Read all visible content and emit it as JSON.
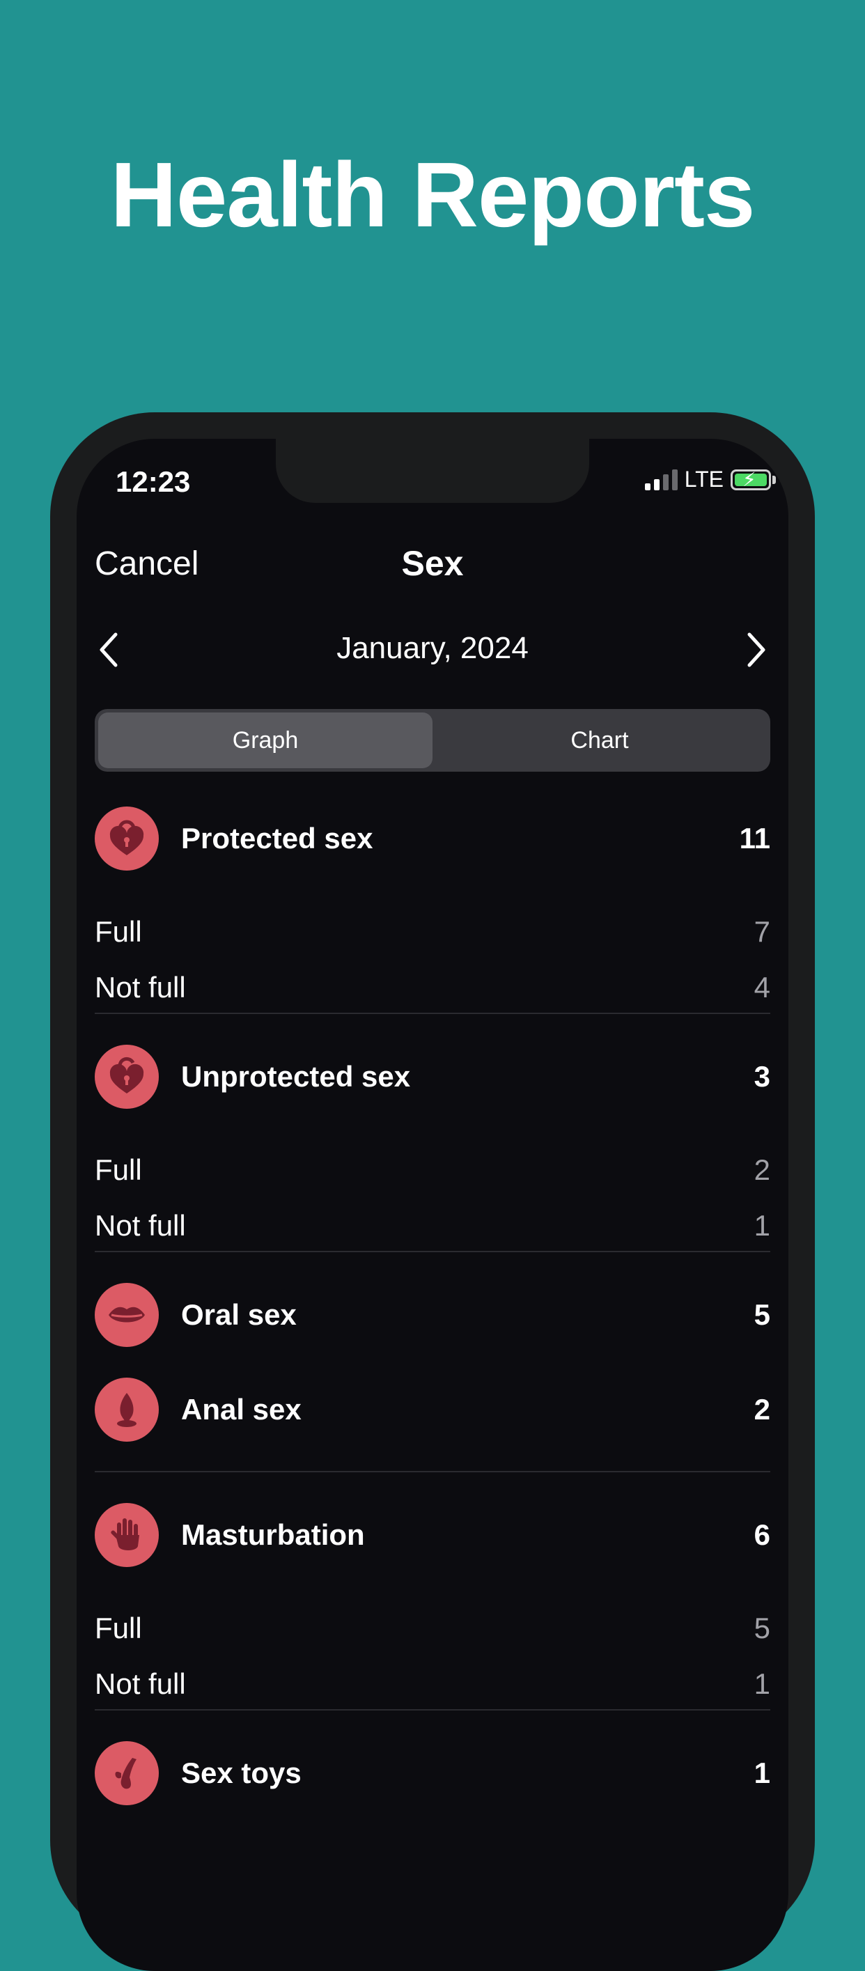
{
  "headline": "Health Reports",
  "status": {
    "time": "12:23",
    "network": "LTE"
  },
  "nav": {
    "cancel": "Cancel",
    "title": "Sex"
  },
  "period": {
    "month": "January, 2024"
  },
  "segments": {
    "graph": "Graph",
    "chart": "Chart",
    "selected": "Graph"
  },
  "categories": [
    {
      "label": "Protected sex",
      "value": "11",
      "icon": "lock-heart-icon",
      "breakdown": [
        {
          "label": "Full",
          "value": "7"
        },
        {
          "label": "Not full",
          "value": "4"
        }
      ]
    },
    {
      "label": "Unprotected sex",
      "value": "3",
      "icon": "unlocked-heart-icon",
      "breakdown": [
        {
          "label": "Full",
          "value": "2"
        },
        {
          "label": "Not full",
          "value": "1"
        }
      ]
    },
    {
      "label": "Oral sex",
      "value": "5",
      "icon": "lips-icon"
    },
    {
      "label": "Anal sex",
      "value": "2",
      "icon": "plug-icon"
    },
    {
      "label": "Masturbation",
      "value": "6",
      "icon": "hand-icon",
      "breakdown": [
        {
          "label": "Full",
          "value": "5"
        },
        {
          "label": "Not full",
          "value": "1"
        }
      ]
    },
    {
      "label": "Sex toys",
      "value": "1",
      "icon": "toy-icon"
    }
  ],
  "colors": {
    "background": "#219391",
    "screen": "#0c0c10",
    "accent": "#dc5b65",
    "icon_glyph": "#7a1f2e",
    "battery": "#4cd964"
  }
}
